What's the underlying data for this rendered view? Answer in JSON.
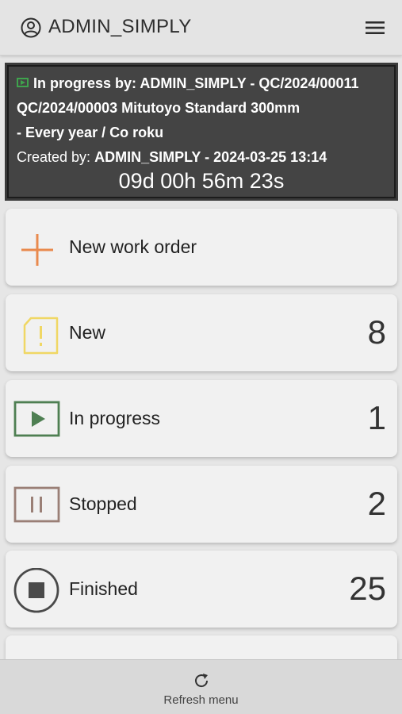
{
  "header": {
    "user_name": "ADMIN_SIMPLY",
    "user_icon": "account-circle-icon",
    "menu_icon": "hamburger-menu-icon"
  },
  "active_task": {
    "status_icon": "play-icon",
    "line1": "In progress by: ADMIN_SIMPLY - QC/2024/00011",
    "line2": "QC/2024/00003 Mitutoyo Standard 300mm",
    "line3": "- Every year / Co roku",
    "created_label": "Created by:",
    "created_value": "ADMIN_SIMPLY - 2024-03-25 13:14",
    "timer": "09d 00h 56m 23s"
  },
  "cards": {
    "new_order": {
      "label": "New work order",
      "icon": "plus-icon",
      "color": "#e98a4e"
    },
    "new": {
      "label": "New",
      "count": "8",
      "icon": "new-document-alert-icon",
      "color": "#f0d764"
    },
    "in_progress": {
      "label": "In progress",
      "count": "1",
      "icon": "play-icon",
      "color": "#4e7f52"
    },
    "stopped": {
      "label": "Stopped",
      "count": "2",
      "icon": "pause-icon",
      "color": "#9a7f76"
    },
    "finished": {
      "label": "Finished",
      "count": "25",
      "icon": "stop-circle-icon",
      "color": "#4a4a4a"
    }
  },
  "footer": {
    "refresh_label": "Refresh menu",
    "refresh_icon": "refresh-icon"
  }
}
